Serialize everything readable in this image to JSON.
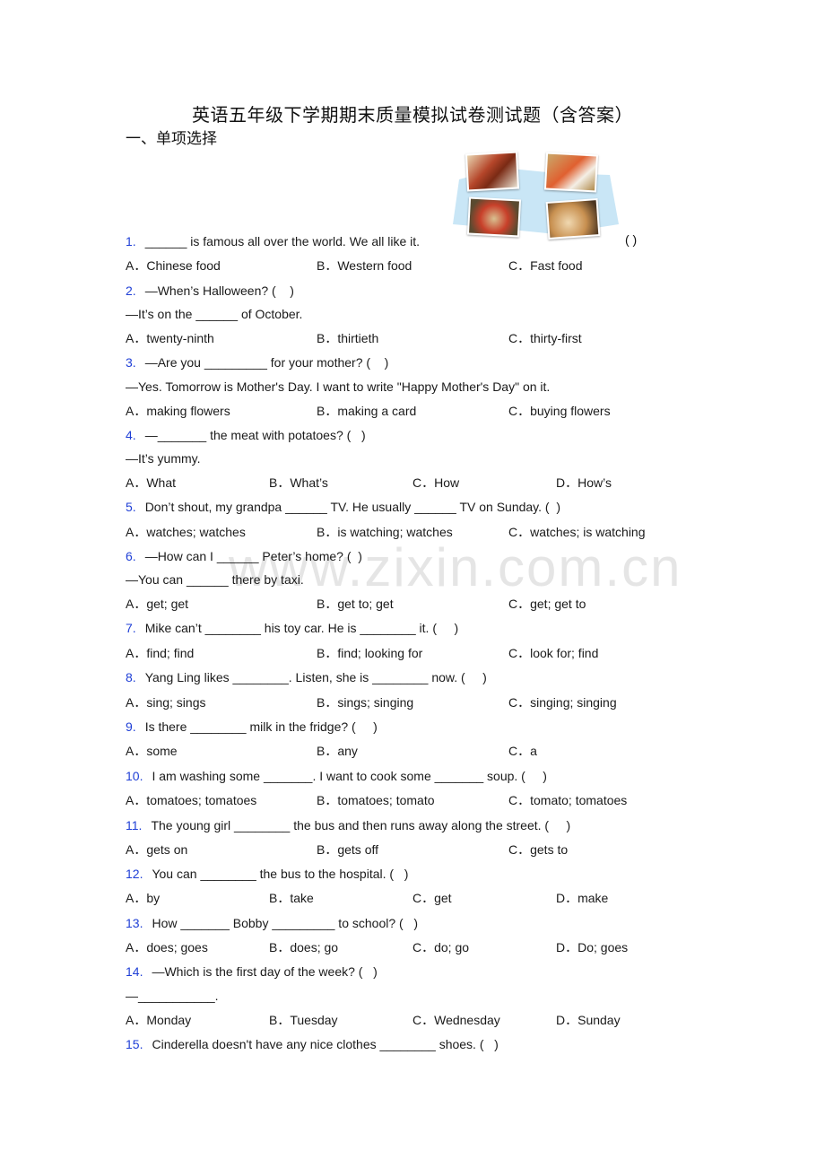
{
  "document": {
    "title": "英语五年级下学期期末质量模拟试卷测试题（含答案）",
    "section_heading": "一、单项选择",
    "watermark": "www.zixin.com.cn",
    "illustration": "Chinese food photos collage",
    "number_color": "#1f3fd6"
  },
  "questions": [
    {
      "num": "1.",
      "lines": [
        "______ is famous all over the world. We all like it."
      ],
      "answer_paren": "( )",
      "options": [
        "A．Chinese food",
        "B．Western food",
        "C．Fast food"
      ]
    },
    {
      "num": "2.",
      "lines": [
        "—When’s Halloween? (    )",
        "—It’s on the ______ of October."
      ],
      "options": [
        "A．twenty-ninth",
        "B．thirtieth",
        "C．thirty-first"
      ]
    },
    {
      "num": "3.",
      "lines": [
        "—Are you _________ for your mother? (    )",
        "—Yes. Tomorrow is Mother's Day. I want to write \"Happy Mother's Day\" on it."
      ],
      "options": [
        "A．making flowers",
        "B．making a card",
        "C．buying flowers"
      ]
    },
    {
      "num": "4.",
      "lines": [
        "—_______ the meat with potatoes? (   )",
        "—It’s yummy."
      ],
      "options": [
        "A．What",
        "B．What’s",
        "C．How",
        "D．How’s"
      ]
    },
    {
      "num": "5.",
      "lines": [
        "Don’t shout, my grandpa ______ TV. He usually ______ TV on Sunday. (  )"
      ],
      "options": [
        "A．watches; watches",
        "B．is watching; watches",
        "C．watches; is watching"
      ]
    },
    {
      "num": "6.",
      "lines": [
        "—How can I ______ Peter’s home? (  )",
        "—You can ______ there by taxi."
      ],
      "options": [
        "A．get; get",
        "B．get to; get",
        "C．get; get to"
      ]
    },
    {
      "num": "7.",
      "lines": [
        "Mike can’t ________ his toy car. He is ________ it. (     )"
      ],
      "options": [
        "A．find; find",
        "B．find; looking for",
        "C．look for; find"
      ]
    },
    {
      "num": "8.",
      "lines": [
        "Yang Ling likes ________. Listen, she is ________ now. (     )"
      ],
      "options": [
        "A．sing; sings",
        "B．sings; singing",
        "C．singing; singing"
      ]
    },
    {
      "num": "9.",
      "lines": [
        "Is there ________ milk in the fridge? (     )"
      ],
      "options": [
        "A．some",
        "B．any",
        "C．a"
      ]
    },
    {
      "num": "10.",
      "lines": [
        "I am washing some _______. I want to cook some _______ soup. (     )"
      ],
      "options": [
        "A．tomatoes; tomatoes",
        "B．tomatoes; tomato",
        "C．tomato; tomatoes"
      ]
    },
    {
      "num": "11.",
      "lines": [
        "The young girl ________ the bus and then runs away along the street. (     )"
      ],
      "options": [
        "A．gets on",
        "B．gets off",
        "C．gets to"
      ]
    },
    {
      "num": "12.",
      "lines": [
        "You can ________ the bus to the hospital. (   )"
      ],
      "options": [
        "A．by",
        "B．take",
        "C．get",
        "D．make"
      ]
    },
    {
      "num": "13.",
      "lines": [
        "How _______ Bobby _________ to school? (   )"
      ],
      "options": [
        "A．does; goes",
        "B．does; go",
        "C．do; go",
        "D．Do; goes"
      ]
    },
    {
      "num": "14.",
      "lines": [
        "—Which is the first day of the week? (   )",
        "—___________."
      ],
      "options": [
        "A．Monday",
        "B．Tuesday",
        "C．Wednesday",
        "D．Sunday"
      ]
    },
    {
      "num": "15.",
      "lines": [
        "Cinderella doesn't have any nice clothes ________ shoes. (   )"
      ],
      "options": []
    }
  ]
}
